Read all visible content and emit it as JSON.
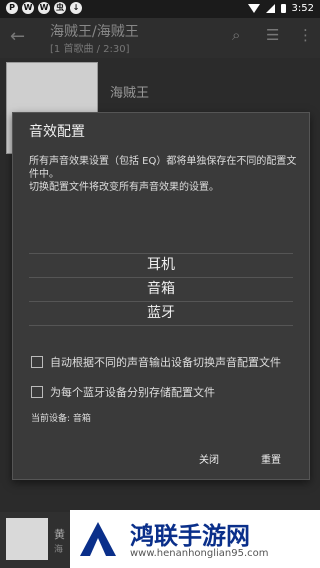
{
  "statusbar": {
    "time": "3:52",
    "icons": [
      "P",
      "W",
      "W",
      "虫",
      "↓"
    ]
  },
  "appbar": {
    "title": "海贼王/海贼王",
    "subtitle": "[1 首歌曲 / 2:30]"
  },
  "album": {
    "title": "海贼王"
  },
  "dialog": {
    "title": "音效配置",
    "description_line1": "所有声音效果设置（包括 EQ）都将单独保存在不同的配置文件中。",
    "description_line2": "切换配置文件将改变所有声音效果的设置。",
    "options": [
      "耳机",
      "音箱",
      "蓝牙"
    ],
    "checkbox1_label": "自动根据不同的声音输出设备切换声音配置文件",
    "checkbox2_label": "为每个蓝牙设备分别存储配置文件",
    "current_device": "当前设备: 音箱",
    "close_label": "关闭",
    "reset_label": "重置"
  },
  "mini": {
    "line1": "黄",
    "line2": "海"
  },
  "watermark": {
    "title": "鸿联手游网",
    "url": "www.henanhonglian95.com"
  },
  "colors": {
    "dialog_bg": "#3a3a3a",
    "watermark_blue": "#0a2f8a"
  }
}
